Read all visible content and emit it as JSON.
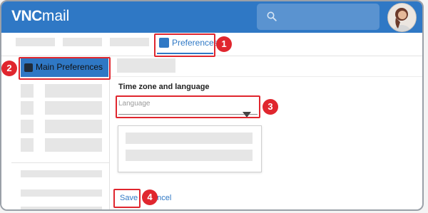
{
  "app": {
    "logo_bold": "VNC",
    "logo_light": "mail"
  },
  "search": {
    "icon": "search-icon"
  },
  "tabs": {
    "active_label": "Preferences",
    "active_icon": "gear-icon"
  },
  "sidebar": {
    "selected_label": "Main Preferences",
    "selected_icon": "gear-icon"
  },
  "main": {
    "section_title": "Time zone and language",
    "language_field_label": "Language",
    "save_label": "Save",
    "cancel_label": "ancel"
  },
  "annotations": {
    "step1": "1",
    "step2": "2",
    "step3": "3",
    "step4": "4"
  },
  "colors": {
    "brand_blue": "#2f78c5",
    "highlight_red": "#e0262e"
  }
}
